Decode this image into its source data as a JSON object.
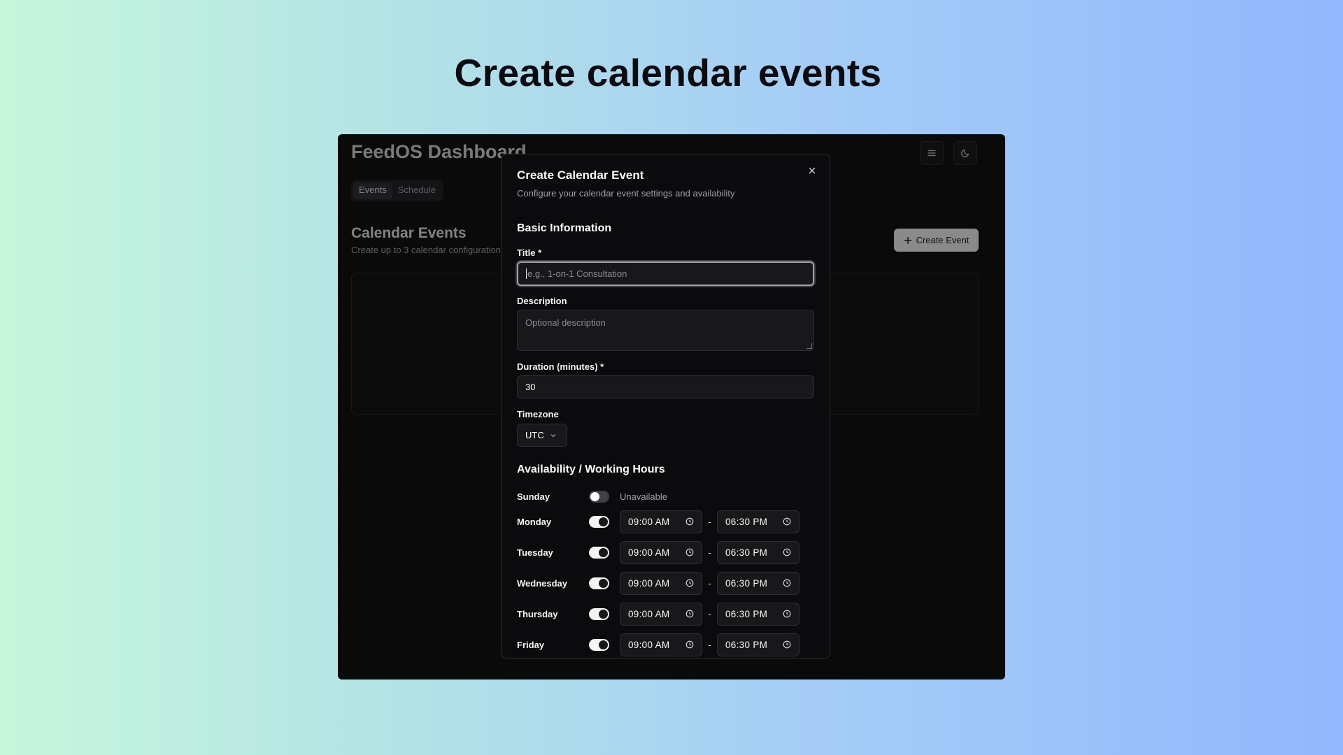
{
  "hero": {
    "title": "Create calendar events"
  },
  "app": {
    "title": "FeedOS Dashboard",
    "tabs": [
      {
        "label": "Events",
        "active": true
      },
      {
        "label": "Schedule",
        "active": false
      }
    ],
    "section_title": "Calendar Events",
    "section_subtitle": "Create up to 3 calendar configurations",
    "create_button": "Create Event"
  },
  "modal": {
    "title": "Create Calendar Event",
    "description": "Configure your calendar event settings and availability",
    "basic_title": "Basic Information",
    "title_label": "Title *",
    "title_placeholder": "e.g., 1-on-1 Consultation",
    "description_label": "Description",
    "description_placeholder": "Optional description",
    "duration_label": "Duration (minutes) *",
    "duration_value": "30",
    "timezone_label": "Timezone",
    "timezone_value": "UTC",
    "availability_title": "Availability / Working Hours",
    "days": [
      {
        "name": "Sunday",
        "enabled": false,
        "status": "Unavailable"
      },
      {
        "name": "Monday",
        "enabled": true,
        "start": "09:00 AM",
        "end": "06:30 PM"
      },
      {
        "name": "Tuesday",
        "enabled": true,
        "start": "09:00 AM",
        "end": "06:30 PM"
      },
      {
        "name": "Wednesday",
        "enabled": true,
        "start": "09:00 AM",
        "end": "06:30 PM"
      },
      {
        "name": "Thursday",
        "enabled": true,
        "start": "09:00 AM",
        "end": "06:30 PM"
      },
      {
        "name": "Friday",
        "enabled": true,
        "start": "09:00 AM",
        "end": "06:30 PM"
      }
    ],
    "range_separator": "-"
  },
  "colors": {
    "accent": "#f4f4f5",
    "background": "#0a0a0b",
    "muted": "#a1a1aa"
  }
}
